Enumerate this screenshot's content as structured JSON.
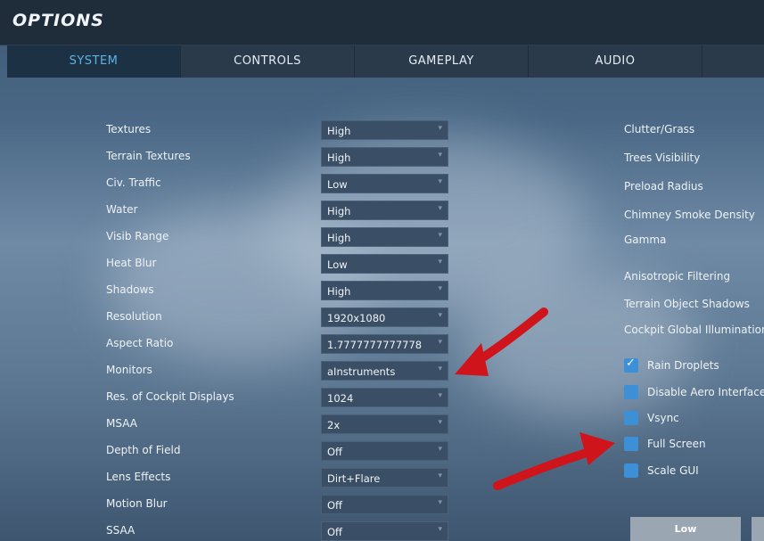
{
  "window": {
    "title": "OPTIONS"
  },
  "tabs": [
    {
      "label": "SYSTEM",
      "active": true
    },
    {
      "label": "CONTROLS"
    },
    {
      "label": "GAMEPLAY"
    },
    {
      "label": "AUDIO"
    }
  ],
  "settings": [
    {
      "label": "Textures",
      "value": "High"
    },
    {
      "label": "Terrain Textures",
      "value": "High"
    },
    {
      "label": "Civ. Traffic",
      "value": "Low"
    },
    {
      "label": "Water",
      "value": "High"
    },
    {
      "label": "Visib Range",
      "value": "High"
    },
    {
      "label": "Heat Blur",
      "value": "Low"
    },
    {
      "label": "Shadows",
      "value": "High"
    },
    {
      "label": "Resolution",
      "value": "1920x1080"
    },
    {
      "label": "Aspect Ratio",
      "value": "1.7777777777778"
    },
    {
      "label": "Monitors",
      "value": "aInstruments"
    },
    {
      "label": "Res. of Cockpit Displays",
      "value": "1024"
    },
    {
      "label": "MSAA",
      "value": "2x"
    },
    {
      "label": "Depth of Field",
      "value": "Off"
    },
    {
      "label": "Lens Effects",
      "value": "Dirt+Flare"
    },
    {
      "label": "Motion Blur",
      "value": "Off"
    },
    {
      "label": "SSAA",
      "value": "Off"
    }
  ],
  "right_settings": [
    {
      "label": "Clutter/Grass"
    },
    {
      "label": "Trees Visibility"
    },
    {
      "label": "Preload Radius"
    },
    {
      "label": "Chimney Smoke Density"
    },
    {
      "label": "Gamma"
    },
    {
      "label": "Anisotropic Filtering"
    },
    {
      "label": "Terrain Object Shadows"
    },
    {
      "label": "Cockpit Global Illumination"
    }
  ],
  "checkboxes": [
    {
      "label": "Rain Droplets",
      "checked": true
    },
    {
      "label": "Disable Aero Interface",
      "checked": false
    },
    {
      "label": "Vsync",
      "checked": false
    },
    {
      "label": "Full Screen",
      "checked": false
    },
    {
      "label": "Scale GUI",
      "checked": false
    }
  ],
  "presets": [
    {
      "label": "Low"
    }
  ],
  "colors": {
    "accent": "#5fb3e0",
    "checkbox": "#3d8fd6",
    "annotation_arrow": "#d0141c"
  },
  "icons": {
    "dropdown": "chevron-down-icon",
    "check": "checkmark-icon"
  }
}
